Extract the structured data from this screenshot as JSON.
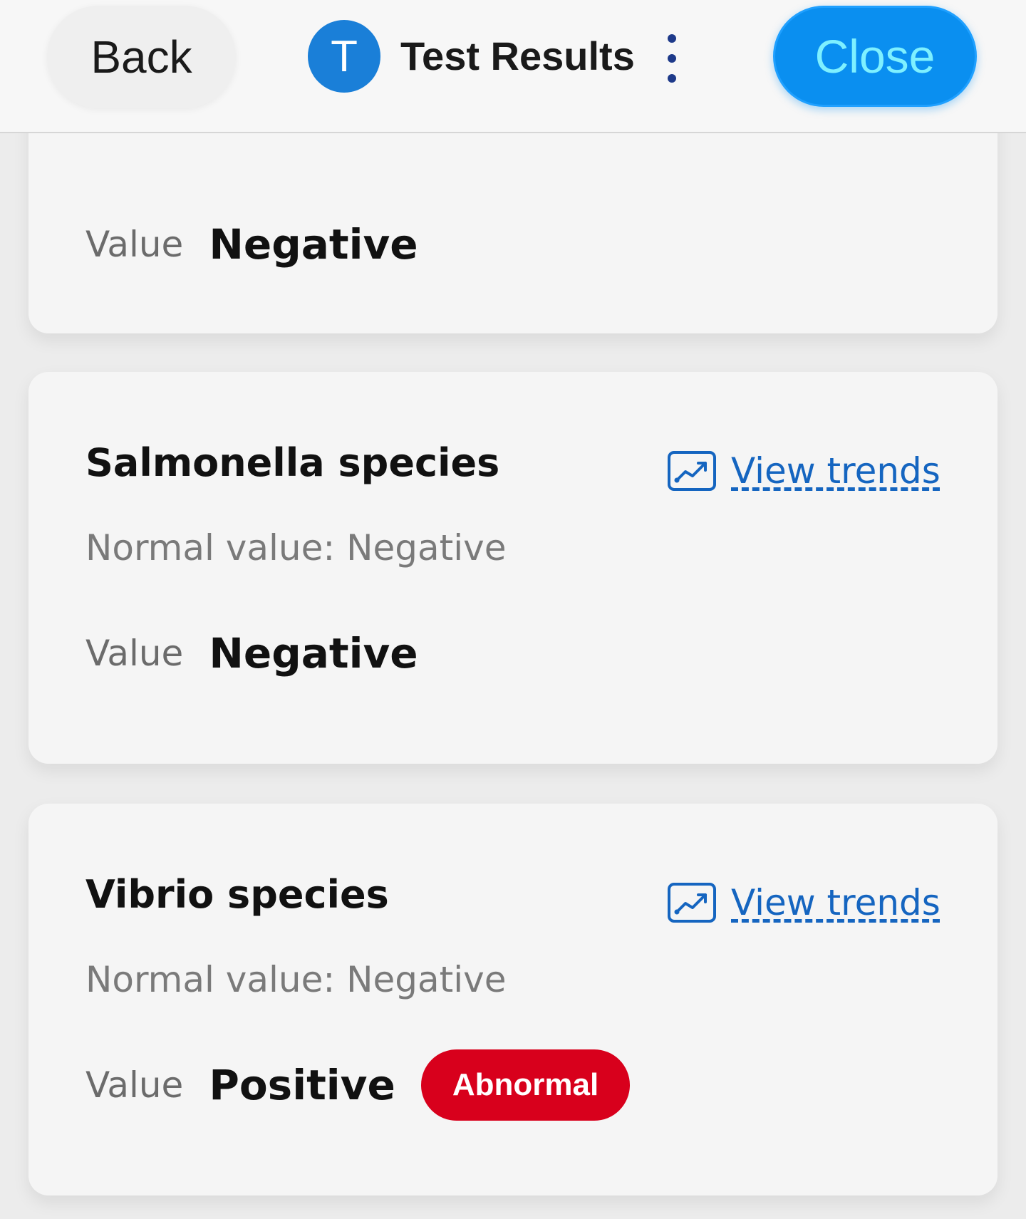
{
  "header": {
    "back_label": "Back",
    "avatar_initial": "T",
    "title": "Test Results",
    "close_label": "Close",
    "accent": "#0a8ff0"
  },
  "results": [
    {
      "value_label": "Value",
      "value": "Negative"
    },
    {
      "name": "Salmonella species",
      "trends_label": "View trends",
      "normal_value": "Normal value: Negative",
      "value_label": "Value",
      "value": "Negative"
    },
    {
      "name": "Vibrio species",
      "trends_label": "View trends",
      "normal_value": "Normal value: Negative",
      "value_label": "Value",
      "value": "Positive",
      "flag": "Abnormal",
      "flag_color": "#d8001c"
    }
  ]
}
